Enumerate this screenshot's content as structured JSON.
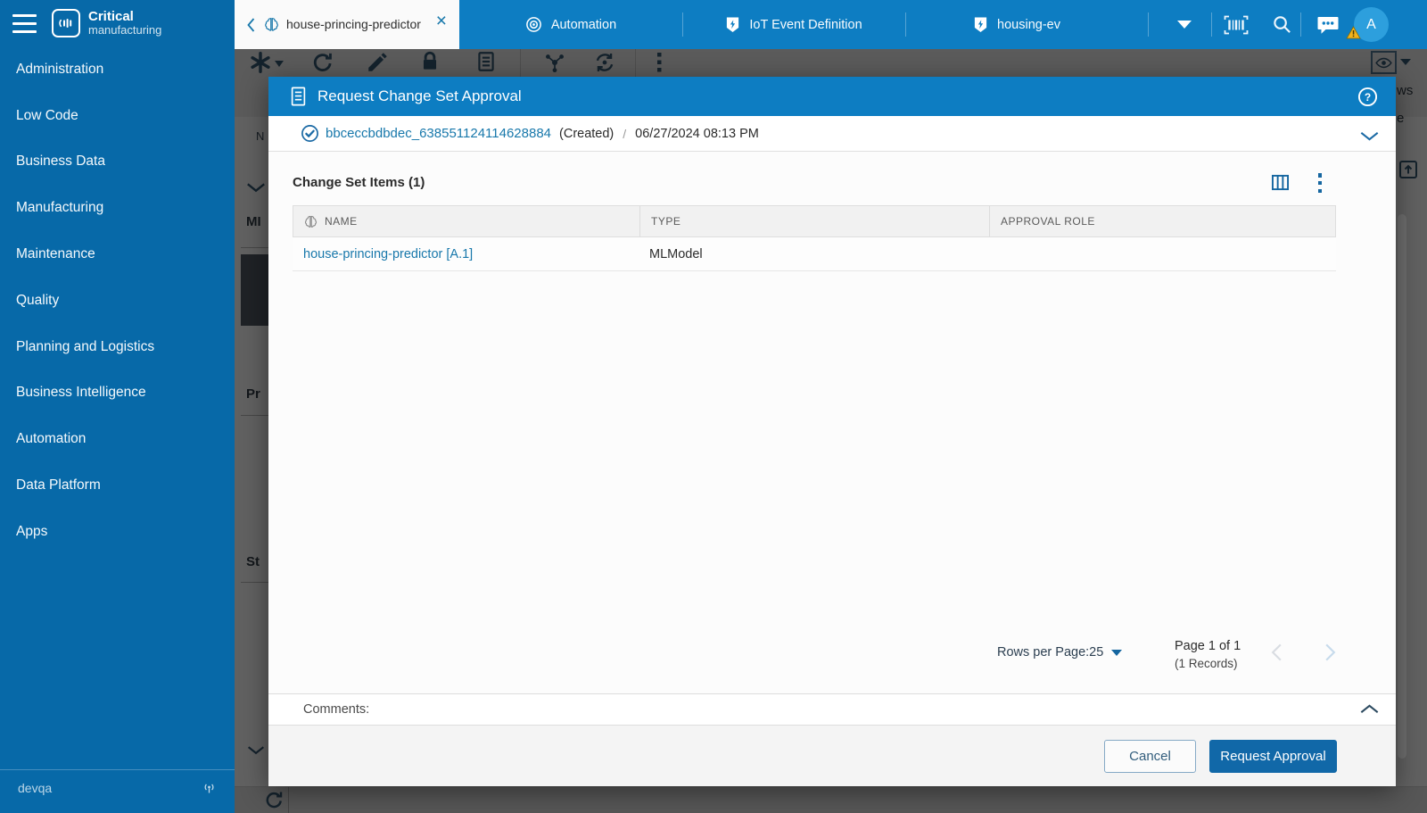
{
  "sidebar": {
    "logo": {
      "line1": "Critical",
      "line2": "manufacturing"
    },
    "items": [
      "Administration",
      "Low Code",
      "Business Data",
      "Manufacturing",
      "Maintenance",
      "Quality",
      "Planning and Logistics",
      "Business Intelligence",
      "Automation",
      "Data Platform",
      "Apps"
    ],
    "environment": "devqa"
  },
  "topbar": {
    "active_tab": {
      "label": "house-princing-predictor"
    },
    "tabs": [
      {
        "label": "Automation"
      },
      {
        "label": "IoT Event Definition"
      },
      {
        "label": "housing-ev"
      }
    ],
    "avatar_initial": "A"
  },
  "modal": {
    "title": "Request Change Set Approval",
    "version": {
      "name": "bbceccbdbdec_638551124114628884",
      "state": "(Created)",
      "separator": "/",
      "timestamp": "06/27/2024 08:13 PM"
    },
    "section_title": "Change Set Items (1)",
    "table": {
      "columns": [
        "NAME",
        "TYPE",
        "APPROVAL ROLE"
      ],
      "rows": [
        {
          "name": "house-princing-predictor [A.1]",
          "type": "MLModel",
          "approval_role": ""
        }
      ]
    },
    "pagination": {
      "rows_per_page_label": "Rows per Page:",
      "rows_per_page_value": "25",
      "page_label": "Page 1 of 1",
      "records_label": "(1 Records)"
    },
    "comments_label": "Comments:",
    "actions": {
      "cancel": "Cancel",
      "submit": "Request Approval"
    }
  },
  "background": {
    "partial_labels": {
      "toolbar_item": "N",
      "section_1": "MI",
      "section_2": "Pr",
      "section_3": "St",
      "right_panel_1": "ws",
      "right_panel_2": "e"
    }
  },
  "colors": {
    "topbar_blue": "#0d7dc2",
    "sidebar_blue": "#0769a8",
    "link_blue": "#1878ab",
    "primary_button_blue": "#1168a8",
    "avatar_blue": "#2d9fdd",
    "warning_yellow": "#f2b21c"
  }
}
